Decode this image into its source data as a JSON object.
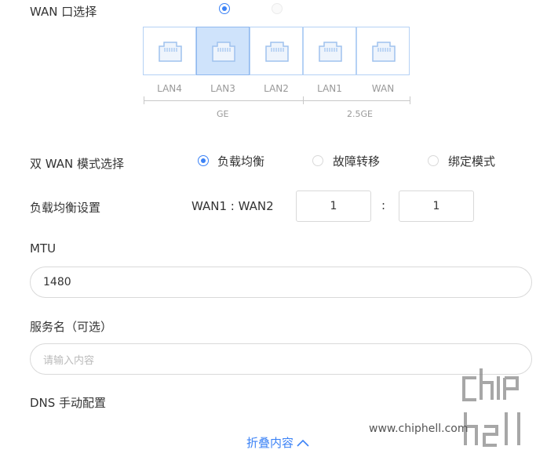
{
  "wan_select": {
    "label": "WAN 口选择",
    "ports": [
      {
        "name": "LAN4"
      },
      {
        "name": "LAN3"
      },
      {
        "name": "LAN2"
      },
      {
        "name": "LAN1"
      },
      {
        "name": "WAN"
      }
    ],
    "selected_port": "LAN3",
    "groups": [
      "GE",
      "2.5GE"
    ]
  },
  "dual_wan": {
    "label": "双 WAN 模式选择",
    "options": [
      "负载均衡",
      "故障转移",
      "绑定模式"
    ],
    "selected": "负载均衡"
  },
  "load_balance": {
    "label": "负载均衡设置",
    "ratio_label": "WAN1 : WAN2",
    "wan1": "1",
    "separator": ":",
    "wan2": "1"
  },
  "mtu": {
    "label": "MTU",
    "value": "1480"
  },
  "service_name": {
    "label": "服务名（可选）",
    "placeholder": "请输入内容"
  },
  "dns": {
    "label": "DNS 手动配置"
  },
  "collapse": {
    "label": "折叠内容"
  },
  "watermark": {
    "site": "www.chiphell.com",
    "logo_text": "chip hell"
  },
  "colors": {
    "accent": "#3b82f6",
    "port_border": "#b5d1f5",
    "port_selected_bg": "#cfe3fb"
  }
}
